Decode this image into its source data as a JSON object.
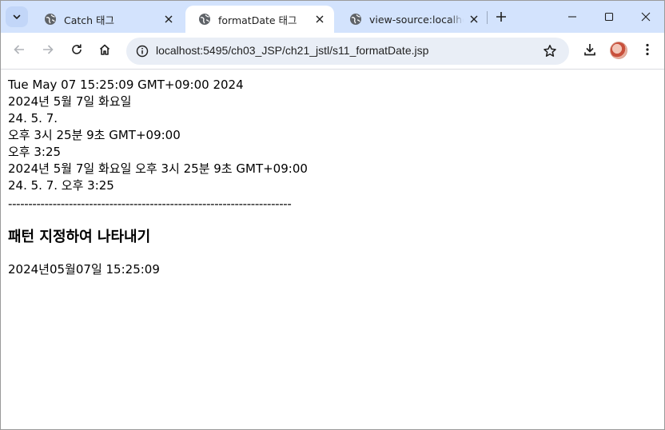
{
  "tabs": [
    {
      "title": "Catch 태그",
      "active": false
    },
    {
      "title": "formatDate 태그",
      "active": true
    },
    {
      "title": "view-source:localhost",
      "active": false
    }
  ],
  "toolbar": {
    "url": "localhost:5495/ch03_JSP/ch21_jstl/s11_formatDate.jsp"
  },
  "content": {
    "lines": [
      "Tue May 07 15:25:09 GMT+09:00 2024",
      "2024년 5월 7일 화요일",
      "24. 5. 7.",
      "오후 3시 25분 9초 GMT+09:00",
      "오후 3:25",
      "2024년 5월 7일 화요일 오후 3시 25분 9초 GMT+09:00",
      "24. 5. 7. 오후 3:25"
    ],
    "divider": "----------------------------------------------------------------------",
    "heading": "패턴 지정하여 나타내기",
    "pattern_result": "2024년05월07일 15:25:09"
  }
}
